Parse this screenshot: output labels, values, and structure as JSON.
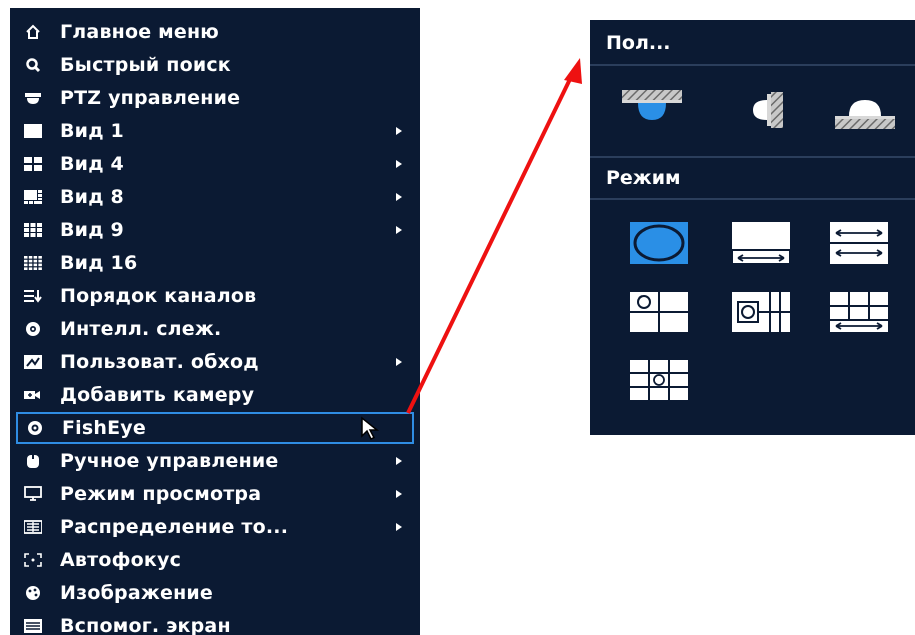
{
  "menu": {
    "items": [
      {
        "label": "Главное меню",
        "icon": "home-icon",
        "submenu": false
      },
      {
        "label": "Быстрый поиск",
        "icon": "search-icon",
        "submenu": false
      },
      {
        "label": "PTZ управление",
        "icon": "ptz-dome-icon",
        "submenu": false
      },
      {
        "label": "Вид 1",
        "icon": "view-1-icon",
        "submenu": true
      },
      {
        "label": "Вид 4",
        "icon": "view-4-icon",
        "submenu": true
      },
      {
        "label": "Вид 8",
        "icon": "view-8-icon",
        "submenu": true
      },
      {
        "label": "Вид 9",
        "icon": "view-9-icon",
        "submenu": true
      },
      {
        "label": "Вид 16",
        "icon": "view-16-icon",
        "submenu": false
      },
      {
        "label": "Порядок каналов",
        "icon": "channel-order-icon",
        "submenu": false
      },
      {
        "label": "Интелл. слеж.",
        "icon": "smart-track-icon",
        "submenu": false
      },
      {
        "label": "Пользоват. обход",
        "icon": "custom-tour-icon",
        "submenu": true
      },
      {
        "label": "Добавить камеру",
        "icon": "add-camera-icon",
        "submenu": false
      },
      {
        "label": "FishEye",
        "icon": "fisheye-icon",
        "submenu": false,
        "selected": true
      },
      {
        "label": "Ручное управление",
        "icon": "manual-control-icon",
        "submenu": true
      },
      {
        "label": "Режим просмотра",
        "icon": "monitor-icon",
        "submenu": true
      },
      {
        "label": "Распределение то...",
        "icon": "distribution-icon",
        "submenu": true
      },
      {
        "label": "Автофокус",
        "icon": "autofocus-icon",
        "submenu": false
      },
      {
        "label": "Изображение",
        "icon": "image-icon",
        "submenu": false
      },
      {
        "label": "Вспомог. экран",
        "icon": "aux-screen-icon",
        "submenu": false
      }
    ]
  },
  "fisheye_panel": {
    "mount_title": "Пол...",
    "mode_title": "Режим",
    "mount_icons": [
      "ceiling-mount-icon",
      "wall-mount-icon",
      "floor-mount-icon"
    ],
    "mode_icons": [
      "mode-1o-icon",
      "mode-1p-icon",
      "mode-2p-icon",
      "mode-1o3r-icon",
      "mode-1o4r-icon",
      "mode-1p6r-icon",
      "mode-1o8r-icon"
    ],
    "selected_mode": "mode-1o-icon"
  },
  "colors": {
    "menu_bg": "#0b1a33",
    "selection_border": "#2f8de4",
    "mode_selected": "#2a8fe6",
    "pointer_arrow": "#ee1111"
  }
}
